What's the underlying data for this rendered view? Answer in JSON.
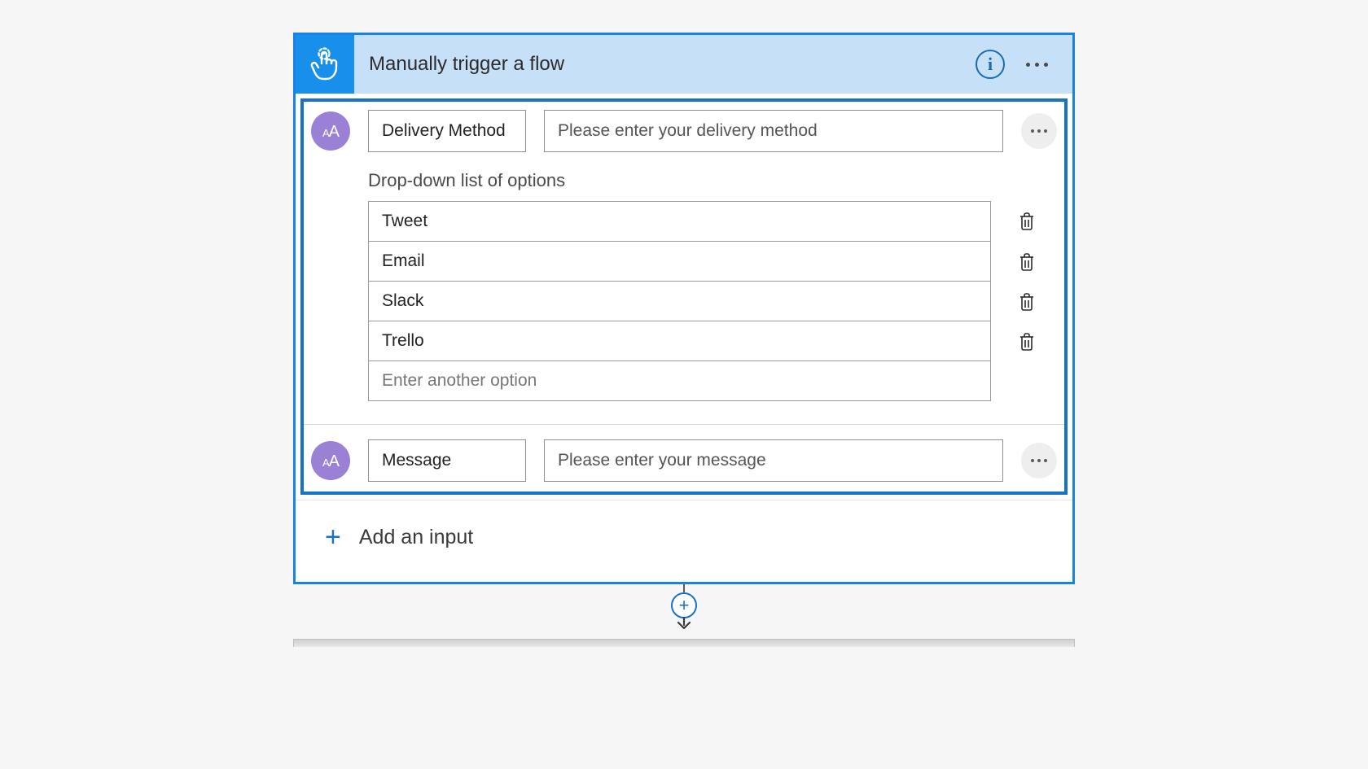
{
  "trigger": {
    "title": "Manually trigger a flow",
    "info_tooltip": "i",
    "inputs": [
      {
        "icon_text_small": "A",
        "icon_text_large": "A",
        "name": "Delivery Method",
        "prompt": "Please enter your delivery method",
        "dropdown": {
          "label": "Drop-down list of options",
          "options": [
            "Tweet",
            "Email",
            "Slack",
            "Trello"
          ],
          "add_placeholder": "Enter another option"
        }
      },
      {
        "icon_text_small": "A",
        "icon_text_large": "A",
        "name": "Message",
        "prompt": "Please enter your message"
      }
    ],
    "add_input_label": "Add an input"
  },
  "connector": {
    "add_label": "+"
  }
}
